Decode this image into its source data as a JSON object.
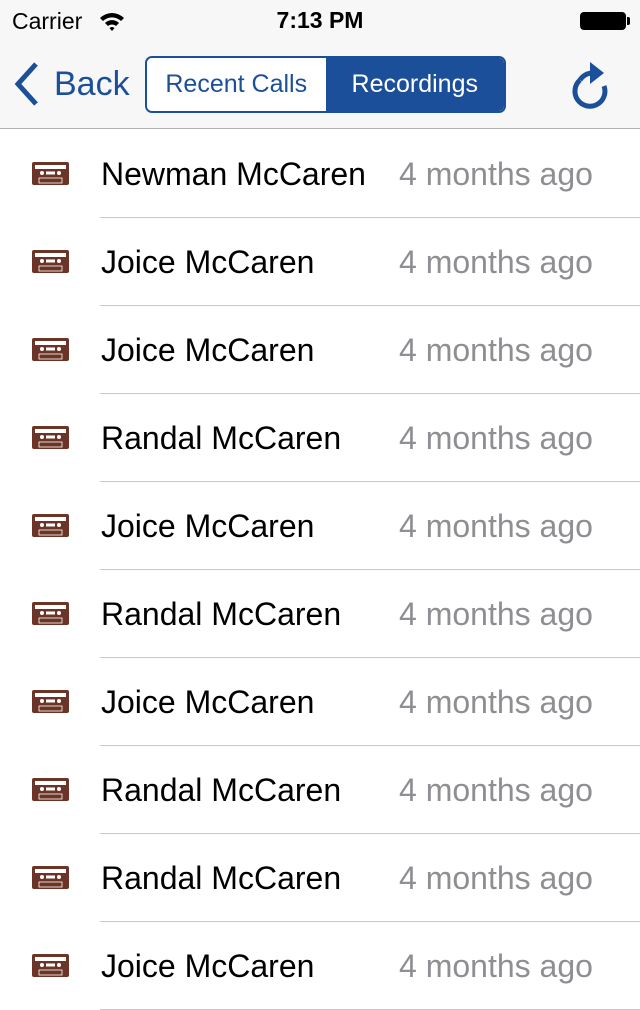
{
  "status_bar": {
    "carrier": "Carrier",
    "time": "7:13 PM"
  },
  "nav": {
    "back_label": "Back",
    "segments": [
      {
        "label": "Recent Calls",
        "selected": false
      },
      {
        "label": "Recordings",
        "selected": true
      }
    ],
    "refresh_icon": "refresh-icon"
  },
  "colors": {
    "accent": "#1c4f9a",
    "cassette": "#6b3427",
    "secondary_text": "#8e8e93"
  },
  "recordings": [
    {
      "name": "Newman McCaren",
      "when": "4 months ago",
      "icon": "cassette-icon"
    },
    {
      "name": "Joice McCaren",
      "when": "4 months ago",
      "icon": "cassette-icon"
    },
    {
      "name": "Joice McCaren",
      "when": "4 months ago",
      "icon": "cassette-icon"
    },
    {
      "name": "Randal McCaren",
      "when": "4 months ago",
      "icon": "cassette-icon"
    },
    {
      "name": "Joice McCaren",
      "when": "4 months ago",
      "icon": "cassette-icon"
    },
    {
      "name": "Randal McCaren",
      "when": "4 months ago",
      "icon": "cassette-icon"
    },
    {
      "name": "Joice McCaren",
      "when": "4 months ago",
      "icon": "cassette-icon"
    },
    {
      "name": "Randal McCaren",
      "when": "4 months ago",
      "icon": "cassette-icon"
    },
    {
      "name": "Randal McCaren",
      "when": "4 months ago",
      "icon": "cassette-icon"
    },
    {
      "name": "Joice McCaren",
      "when": "4 months ago",
      "icon": "cassette-icon"
    }
  ]
}
